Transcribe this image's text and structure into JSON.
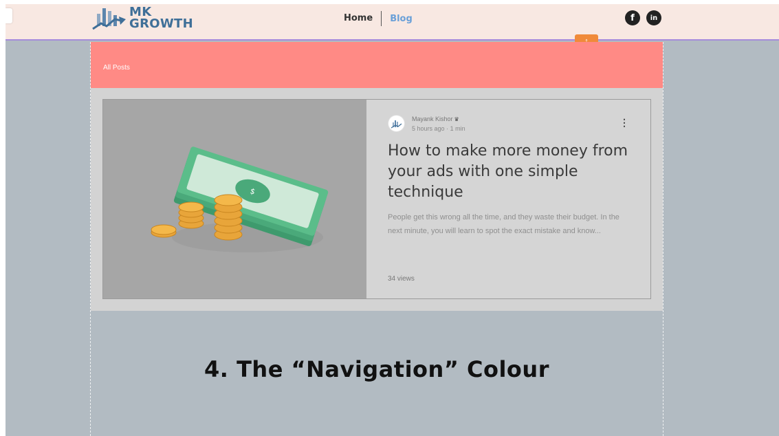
{
  "header": {
    "logo_line1": "MK",
    "logo_line2": "GROWTH",
    "nav": {
      "home": "Home",
      "blog": "Blog"
    },
    "social": {
      "facebook": "f",
      "linkedin": "in"
    },
    "handle_glyph": "↕"
  },
  "blog": {
    "all_posts": "All Posts",
    "post": {
      "author": "Mayank Kishor",
      "time": "5 hours ago",
      "read_time": "1 min",
      "title": "How to make more money from your ads with one simple technique",
      "excerpt": "People get this wrong all the time, and they waste their budget. In the next minute, you will learn to spot the exact mistake and know...",
      "views": "34 views",
      "more": "⋮"
    }
  },
  "caption": "4. The “Navigation” Colour",
  "colors": {
    "header_bg": "#f8e8e2",
    "all_posts_bg": "#ff8a85",
    "canvas_bg": "#b2bbc2",
    "logo": "#3f6f98",
    "nav_active": "#6aa0d8",
    "handle": "#f08a3a"
  }
}
